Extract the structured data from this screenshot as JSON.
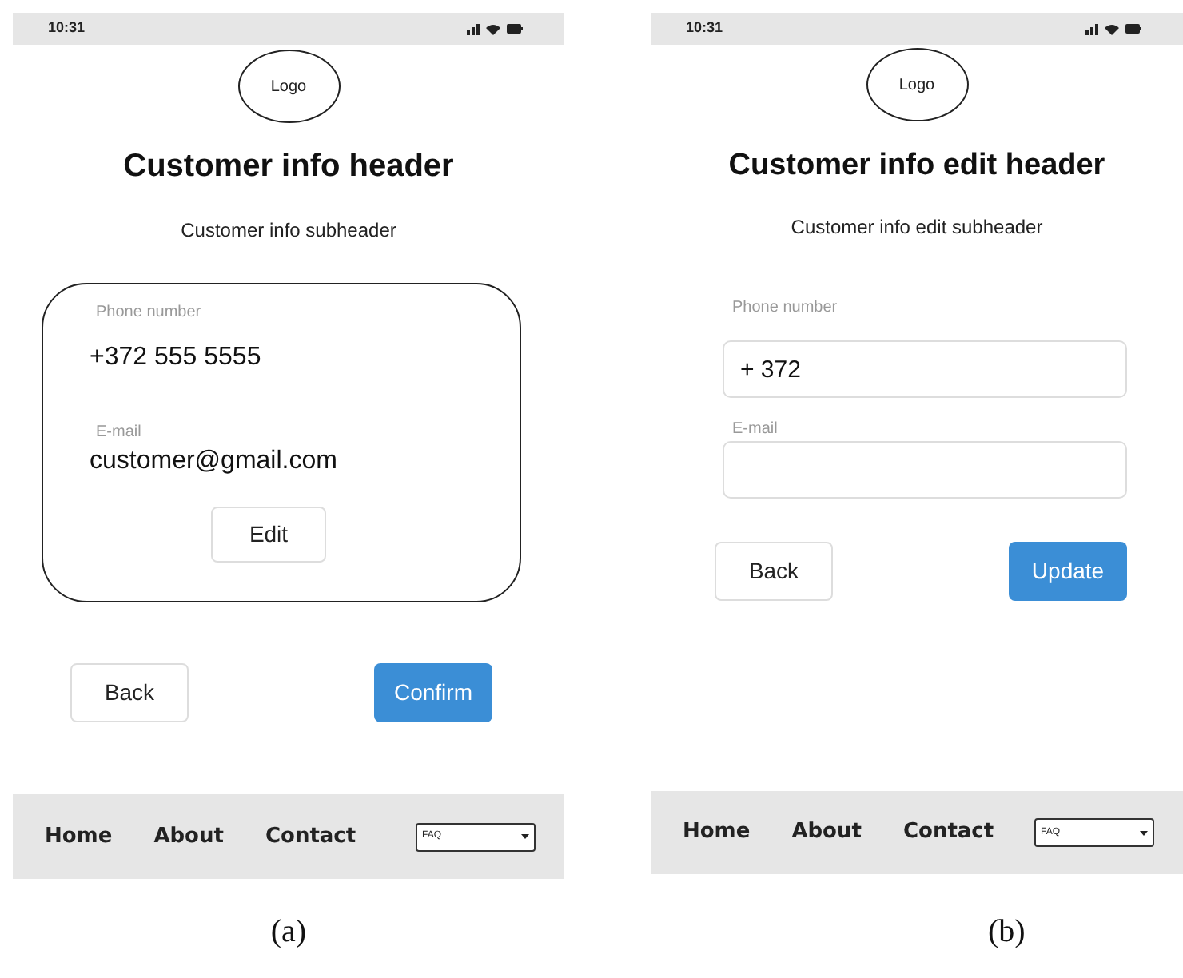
{
  "screens": [
    {
      "kind": "info",
      "status_time": "10:31",
      "logo": "Logo",
      "header": "Customer info header",
      "subheader": "Customer info subheader",
      "card": {
        "fields": [
          {
            "label": "Phone number",
            "value": "+372 555 5555"
          },
          {
            "label": "E-mail",
            "value": "customer@gmail.com"
          }
        ],
        "edit_button": "Edit"
      },
      "buttons": [
        {
          "label": "Back",
          "primary": false
        },
        {
          "label": "Confirm",
          "primary": true
        }
      ],
      "nav": {
        "links": [
          "Home",
          "About",
          "Contact"
        ],
        "select": "FAQ"
      },
      "caption": "(a)"
    },
    {
      "kind": "edit",
      "status_time": "10:31",
      "logo": "Logo",
      "header": "Customer info edit header",
      "subheader": "Customer info edit subheader",
      "fields": [
        {
          "label": "Phone number",
          "value": "+ 372"
        },
        {
          "label": "E-mail"
        }
      ],
      "buttons": [
        {
          "label": "Back",
          "primary": false
        },
        {
          "label": "Update",
          "primary": true
        }
      ],
      "nav": {
        "links": [
          "Home",
          "About",
          "Contact"
        ],
        "select": "FAQ"
      },
      "caption": "(b)"
    }
  ]
}
